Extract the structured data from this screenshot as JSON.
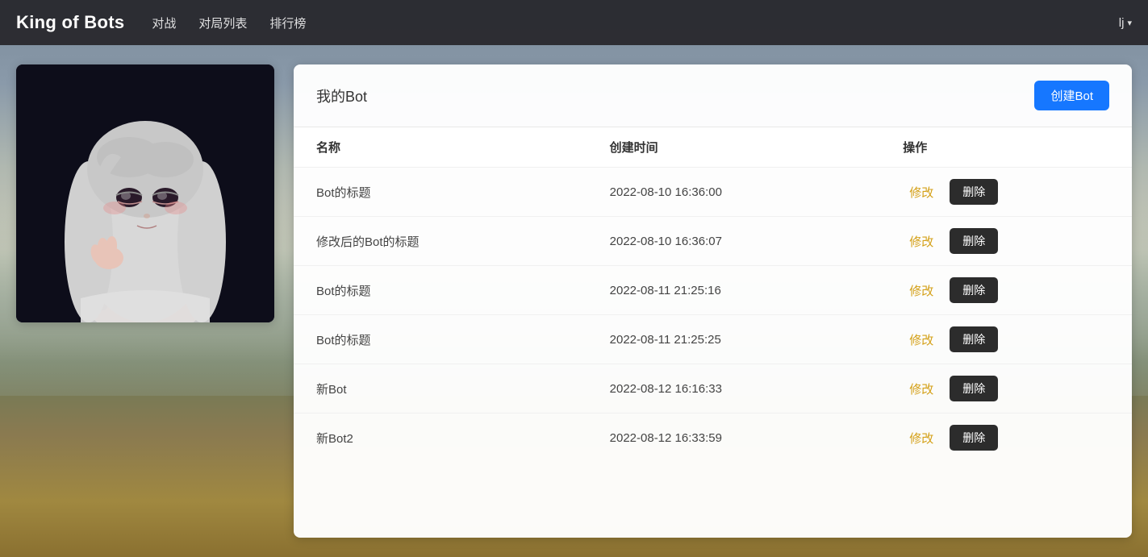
{
  "app": {
    "title": "King of Bots"
  },
  "navbar": {
    "brand": "King of Bots",
    "links": [
      {
        "label": "对战",
        "key": "battle"
      },
      {
        "label": "对局列表",
        "key": "match-list"
      },
      {
        "label": "排行榜",
        "key": "leaderboard"
      }
    ],
    "user": "lj"
  },
  "bot_panel": {
    "title": "我的Bot",
    "create_button": "创建Bot",
    "table": {
      "headers": [
        "名称",
        "创建时间",
        "操作"
      ],
      "edit_label": "修改",
      "delete_label": "删除",
      "rows": [
        {
          "name": "Bot的标题",
          "created_at": "2022-08-10 16:36:00"
        },
        {
          "name": "修改后的Bot的标题",
          "created_at": "2022-08-10 16:36:07"
        },
        {
          "name": "Bot的标题",
          "created_at": "2022-08-11 21:25:16"
        },
        {
          "name": "Bot的标题",
          "created_at": "2022-08-11 21:25:25"
        },
        {
          "name": "新Bot",
          "created_at": "2022-08-12 16:16:33"
        },
        {
          "name": "新Bot2",
          "created_at": "2022-08-12 16:33:59"
        }
      ]
    }
  }
}
